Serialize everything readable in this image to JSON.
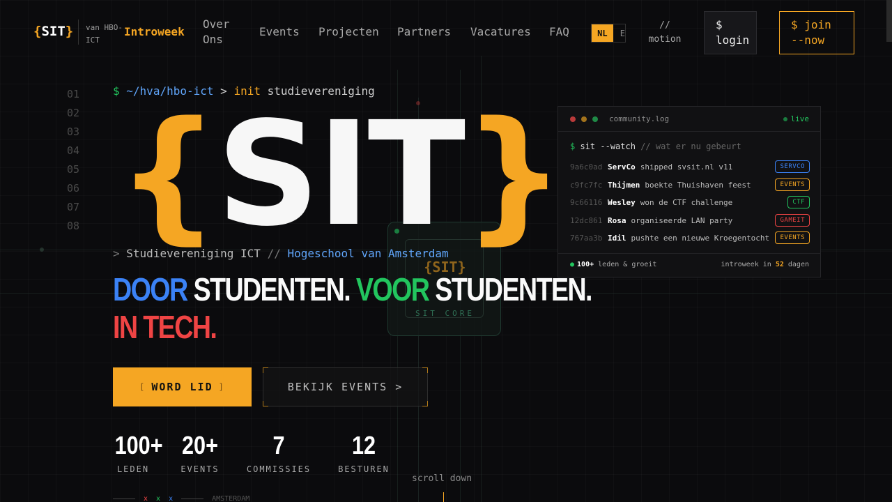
{
  "nav": {
    "logo": {
      "open": "{",
      "text": "SIT",
      "close": "}"
    },
    "logo_sub": "van HBO-ICT",
    "links": [
      {
        "label": "Introweek",
        "active": true
      },
      {
        "label": "Over Ons",
        "active": false
      },
      {
        "label": "Events",
        "active": false
      },
      {
        "label": "Projecten",
        "active": false
      },
      {
        "label": "Partners",
        "active": false
      },
      {
        "label": "Vacatures",
        "active": false
      },
      {
        "label": "FAQ",
        "active": false
      }
    ],
    "lang_active": "NL",
    "lang_other": "E",
    "motion": "// motion",
    "login": "$ login",
    "join": "$ join --now"
  },
  "hero": {
    "line_numbers": [
      "01",
      "02",
      "03",
      "04",
      "05",
      "06",
      "07",
      "08"
    ],
    "prompt": {
      "symbol": "$",
      "path": "~/hva/hbo-ict",
      "arrow": ">",
      "cmd": "init",
      "arg": "studievereniging"
    },
    "logo": {
      "open": "{",
      "text": "SIT",
      "close": "}"
    },
    "tagline": {
      "arrow": ">",
      "org": "Studievereniging ICT",
      "sep": "//",
      "school": "Hogeschool van Amsterdam"
    },
    "slogan": {
      "w1": "DOOR",
      "w2": "STUDENTEN.",
      "w3": "VOOR",
      "w4": "STUDENTEN.",
      "w5": "IN TECH."
    },
    "cta_primary": "WORD LID",
    "cta_primary_bracket_l": "[",
    "cta_primary_bracket_r": "]",
    "cta_secondary": "BEKIJK EVENTS >",
    "stats": [
      {
        "value": "100+",
        "label": "LEDEN"
      },
      {
        "value": "20+",
        "label": "EVENTS"
      },
      {
        "value": "7",
        "label": "COMMISSIES"
      },
      {
        "value": "12",
        "label": "BESTUREN"
      }
    ],
    "scroll": "scroll down",
    "bottom": {
      "x1": "x",
      "x2": "x",
      "x3": "x",
      "city": "AMSTERDAM"
    }
  },
  "chip": {
    "logo": "{SIT}",
    "label": "SIT CORE"
  },
  "terminal": {
    "title": "community.log",
    "live": "live",
    "cmd_symbol": "$",
    "cmd": "sit --watch",
    "cmd_comment": "// wat er nu gebeurt",
    "rows": [
      {
        "hash": "9a6c0ad",
        "user": "ServCo",
        "msg": "shipped svsit.nl v11",
        "tag": "SERVCO",
        "color": "#3b82f6"
      },
      {
        "hash": "c9fc7fc",
        "user": "Thijmen",
        "msg": "boekte Thuishaven feest",
        "tag": "EVENTS",
        "color": "#f5a623"
      },
      {
        "hash": "9c66116",
        "user": "Wesley",
        "msg": "won de CTF challenge",
        "tag": "CTF",
        "color": "#22c55e"
      },
      {
        "hash": "12dc861",
        "user": "Rosa",
        "msg": "organiseerde LAN party",
        "tag": "GAMEIT",
        "color": "#ef4444"
      },
      {
        "hash": "767aa3b",
        "user": "Idil",
        "msg": "pushte een nieuwe Kroegentocht",
        "tag": "EVENTS",
        "color": "#f5a623"
      }
    ],
    "foot_dot": "●",
    "foot_count": "100+",
    "foot_text": "leden & groeit",
    "foot_right_pre": "introweek in",
    "foot_days": "52",
    "foot_right_post": "dagen"
  },
  "colors": {
    "accent": "#f5a623",
    "blue": "#3b82f6",
    "green": "#22c55e",
    "red": "#ef4444"
  }
}
